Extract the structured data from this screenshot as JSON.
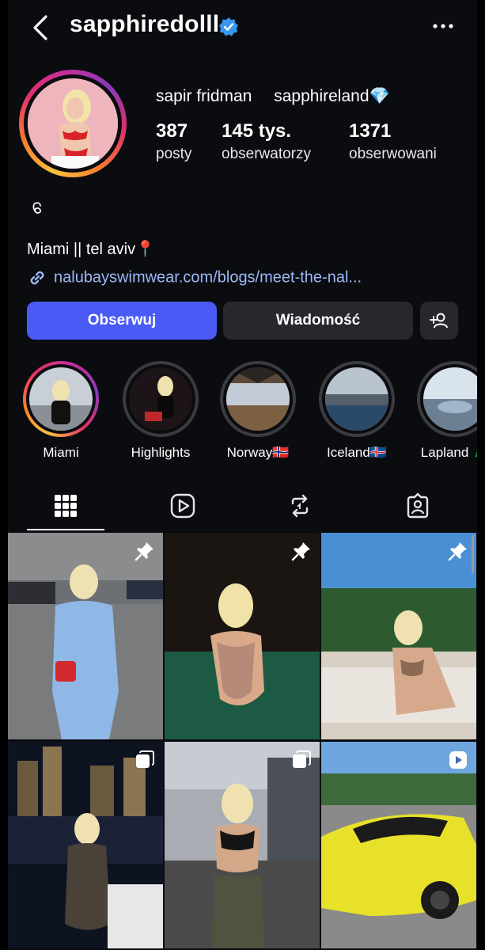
{
  "header": {
    "username": "sapphiredolll",
    "back_icon": "chevron-left-icon",
    "verified_icon": "verified-badge-icon",
    "more_icon": "more-horizontal-icon"
  },
  "profile": {
    "full_name": "sapir fridman",
    "threads_handle": "sapphireland💎",
    "stats": [
      {
        "value": "387",
        "label": "posty"
      },
      {
        "value": "145 tys.",
        "label": "obserwatorzy"
      },
      {
        "value": "1371",
        "label": "obserwowani"
      }
    ],
    "threads_icon": "threads-icon",
    "bio": "Miami || tel aviv📍",
    "link": "nalubayswimwear.com/blogs/meet-the-nal..."
  },
  "actions": {
    "follow_label": "Obserwuj",
    "message_label": "Wiadomość",
    "add_user_icon": "add-person-icon"
  },
  "highlights": [
    {
      "label": "Miami"
    },
    {
      "label": "Highlights"
    },
    {
      "label": "Norway🇳🇴"
    },
    {
      "label": "Iceland🇮🇸"
    },
    {
      "label": "Lapland 🎄"
    }
  ],
  "tabs": [
    "grid-icon",
    "reels-icon",
    "reposts-icon",
    "tagged-icon"
  ],
  "grid": {
    "tiles": [
      {
        "badge": "pin-icon"
      },
      {
        "badge": "pin-icon"
      },
      {
        "badge": "pin-icon"
      },
      {
        "badge": "carousel-icon"
      },
      {
        "badge": "carousel-icon"
      },
      {
        "badge": "reel-icon"
      }
    ]
  },
  "colors": {
    "background": "#0b0c10",
    "accent_button": "#4a5af5",
    "secondary_button": "#26282e",
    "link": "#9cb8f5",
    "verified": "#3897f0"
  }
}
